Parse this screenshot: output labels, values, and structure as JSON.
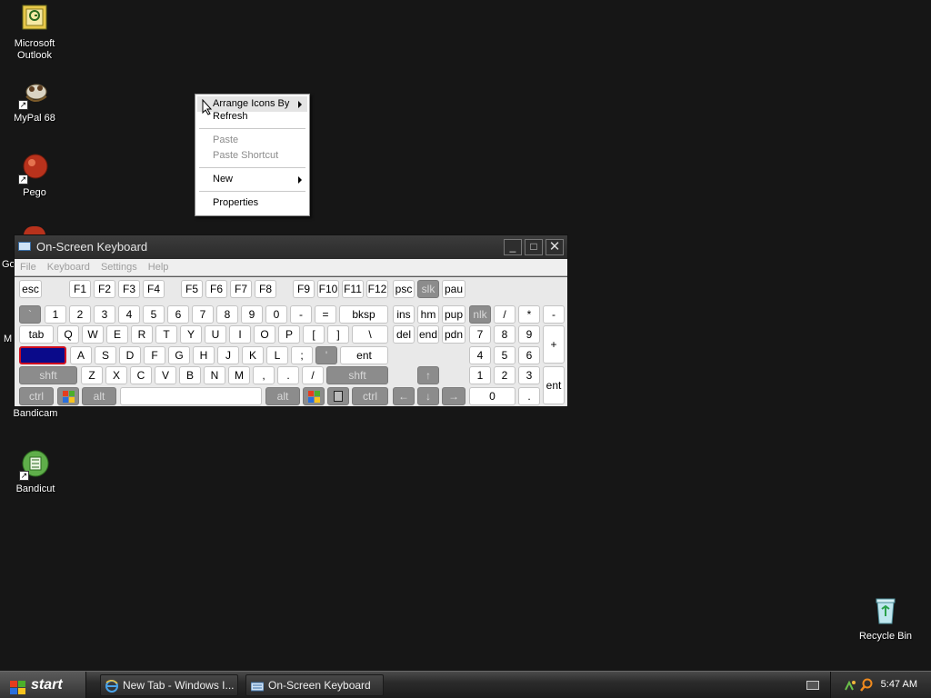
{
  "desktop": {
    "icons": [
      {
        "label": "Microsoft Outlook",
        "line1": "Microsoft",
        "line2": "Outlook",
        "icon": "outlook-icon"
      },
      {
        "label": "MyPal 68",
        "icon": "mypal-icon"
      },
      {
        "label": "Pego",
        "icon": "pego-icon"
      },
      {
        "label": "Bandicam",
        "icon": "bandicam-icon"
      },
      {
        "label": "Bandicut",
        "icon": "bandicut-icon"
      },
      {
        "label": "Recycle Bin",
        "icon": "recycle-bin-icon"
      }
    ],
    "partial_labels": [
      "Go",
      "M"
    ]
  },
  "context_menu": {
    "items": [
      {
        "label": "Arrange Icons By",
        "submenu": true,
        "enabled": true
      },
      {
        "label": "Refresh",
        "submenu": false,
        "enabled": true
      },
      {
        "label": "Paste",
        "submenu": false,
        "enabled": false
      },
      {
        "label": "Paste Shortcut",
        "submenu": false,
        "enabled": false
      },
      {
        "label": "New",
        "submenu": true,
        "enabled": true
      },
      {
        "label": "Properties",
        "submenu": false,
        "enabled": true
      }
    ]
  },
  "osk": {
    "title": "On-Screen Keyboard",
    "menu": [
      "File",
      "Keyboard",
      "Settings",
      "Help"
    ],
    "keys": {
      "esc": "esc",
      "f1": "F1",
      "f2": "F2",
      "f3": "F3",
      "f4": "F4",
      "f5": "F5",
      "f6": "F6",
      "f7": "F7",
      "f8": "F8",
      "f9": "F9",
      "f10": "F10",
      "f11": "F11",
      "f12": "F12",
      "psc": "psc",
      "slk": "slk",
      "pau": "pau",
      "grave": "`",
      "n1": "1",
      "n2": "2",
      "n3": "3",
      "n4": "4",
      "n5": "5",
      "n6": "6",
      "n7": "7",
      "n8": "8",
      "n9": "9",
      "n0": "0",
      "minus": "-",
      "equals": "=",
      "bksp": "bksp",
      "ins": "ins",
      "hm": "hm",
      "pup": "pup",
      "nlk": "nlk",
      "np_div": "/",
      "np_mul": "*",
      "np_sub": "-",
      "tab": "tab",
      "q": "Q",
      "w": "W",
      "e": "E",
      "r": "R",
      "t": "T",
      "y": "Y",
      "u": "U",
      "i": "I",
      "o": "O",
      "p": "P",
      "lbr": "[",
      "rbr": "]",
      "bslash": "\\",
      "del": "del",
      "end": "end",
      "pdn": "pdn",
      "np7": "7",
      "np8": "8",
      "np9": "9",
      "np_add": "+",
      "a": "A",
      "s": "S",
      "d": "D",
      "f": "F",
      "g": "G",
      "h": "H",
      "j": "J",
      "k": "K",
      "l": "L",
      "semi": ";",
      "quote": "'",
      "ent": "ent",
      "np4": "4",
      "np5": "5",
      "np6": "6",
      "lshft": "shft",
      "z": "Z",
      "x": "X",
      "c": "C",
      "v": "V",
      "b": "B",
      "n": "N",
      "m": "M",
      "comma": ",",
      "period": ".",
      "slash": "/",
      "rshft": "shft",
      "up": "↑",
      "np1": "1",
      "np2": "2",
      "np3": "3",
      "np_ent": "ent",
      "lctrl": "ctrl",
      "lalt": "alt",
      "ralt": "alt",
      "rctrl": "ctrl",
      "left": "←",
      "down": "↓",
      "right": "→",
      "np0": "0",
      "np_dot": "."
    }
  },
  "taskbar": {
    "start": "start",
    "tasks": [
      {
        "label": "New Tab - Windows I...",
        "icon": "internet-explorer-icon"
      },
      {
        "label": "On-Screen Keyboard",
        "icon": "keyboard-icon"
      }
    ],
    "clock": "5:47 AM"
  }
}
